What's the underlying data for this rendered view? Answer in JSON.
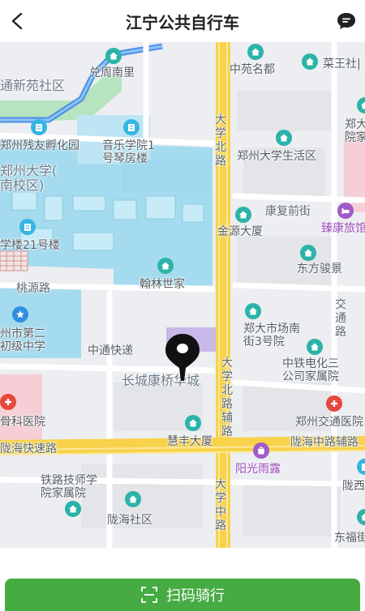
{
  "header": {
    "title": "江宁公共自行车",
    "back_icon": "chevron-left-icon",
    "message_icon": "chat-bubble-icon"
  },
  "map": {
    "labels": {
      "dongtongxinyuan": "通新苑社区",
      "xiongnan": "兑周南里",
      "zhongyuan": "中苑名都",
      "caiwang": "菜王社|",
      "zheng_right_top": "郑大",
      "yuanjia": "院家",
      "canyou": "郑州残友孵化园",
      "yinyue": "音乐学院1",
      "qinfang": "号琴房楼",
      "daxuebei_road": "大学北路",
      "shenghuo": "郑州大学生活区",
      "zhengda_nanxiao": "郑州大学(",
      "nanxiaoqu": "南校区)",
      "kangfu": "康复前街",
      "zhenkang": "臻康旅馆",
      "jinyuan": "金源大厦",
      "xuelou": "学楼21号楼",
      "dongfang": "东方骏景",
      "taoyuan_road": "桃源路",
      "hanlin": "翰林世家",
      "jiaotong_road": "交通路",
      "zhengdier": "州市第二",
      "chuji": "初级中学",
      "shichang": "郑大市场南",
      "jie3": "街3号院",
      "zhongtong": "中通快递",
      "zhongtie": "中铁电化三",
      "gongsi": "公司家属院",
      "changcheng": "长城康桥华城",
      "daxuebei_fu": "大学北路辅路",
      "guke": "骨科医院",
      "jiaotongyiyuan": "郑州交通医院",
      "huifeng": "慧丰大厦",
      "longhai_exp": "陇海快速路",
      "longhai_mid_fu": "陇海中路辅路",
      "yangguang": "阳光雨露",
      "tielu": "铁路技师学",
      "yuanjiashuyuan": "院家属院",
      "daxuezhong_road": "大学中路",
      "longxi": "陇西",
      "longhai_shequ": "陇海社区",
      "dongfu": "东福街"
    },
    "pin_icon": "location-pin-icon",
    "poi_icons": {
      "blue": "building-icon",
      "teal": "home-icon",
      "red": "hospital-icon",
      "purple": "hotel-icon",
      "shop": "shop-icon",
      "school": "school-star-icon"
    },
    "colors": {
      "background": "#eceef1",
      "campus": "#a5dbef",
      "park": "#b6e3c0",
      "hospital": "#f5cfd5",
      "main_road": "#f7d24a",
      "road": "#ffffff",
      "river": "#4a8fe8"
    }
  },
  "bottom": {
    "scan_label": "扫码骑行",
    "scan_icon": "scan-frame-icon",
    "scan_color": "#46ab43"
  }
}
